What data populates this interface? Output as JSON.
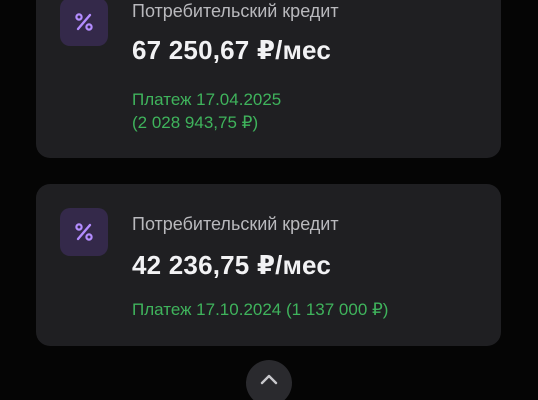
{
  "credits": [
    {
      "icon": "percent-icon",
      "title": "Потребительский кредит",
      "amount": "67 250,67 ₽/мес",
      "payment_line1": "Платеж 17.04.2025",
      "payment_line2": "(2 028 943,75 ₽)"
    },
    {
      "icon": "percent-icon",
      "title": "Потребительский кредит",
      "amount": "42 236,75 ₽/мес",
      "payment_line1": "Платеж 17.10.2024 (1 137 000 ₽)"
    }
  ],
  "collapse_button": {
    "icon": "chevron-up-icon"
  },
  "colors": {
    "background": "#050505",
    "card": "#1f1f22",
    "icon_bg": "#34294a",
    "icon_accent": "#b38cff",
    "payment_green": "#3fb35c"
  }
}
